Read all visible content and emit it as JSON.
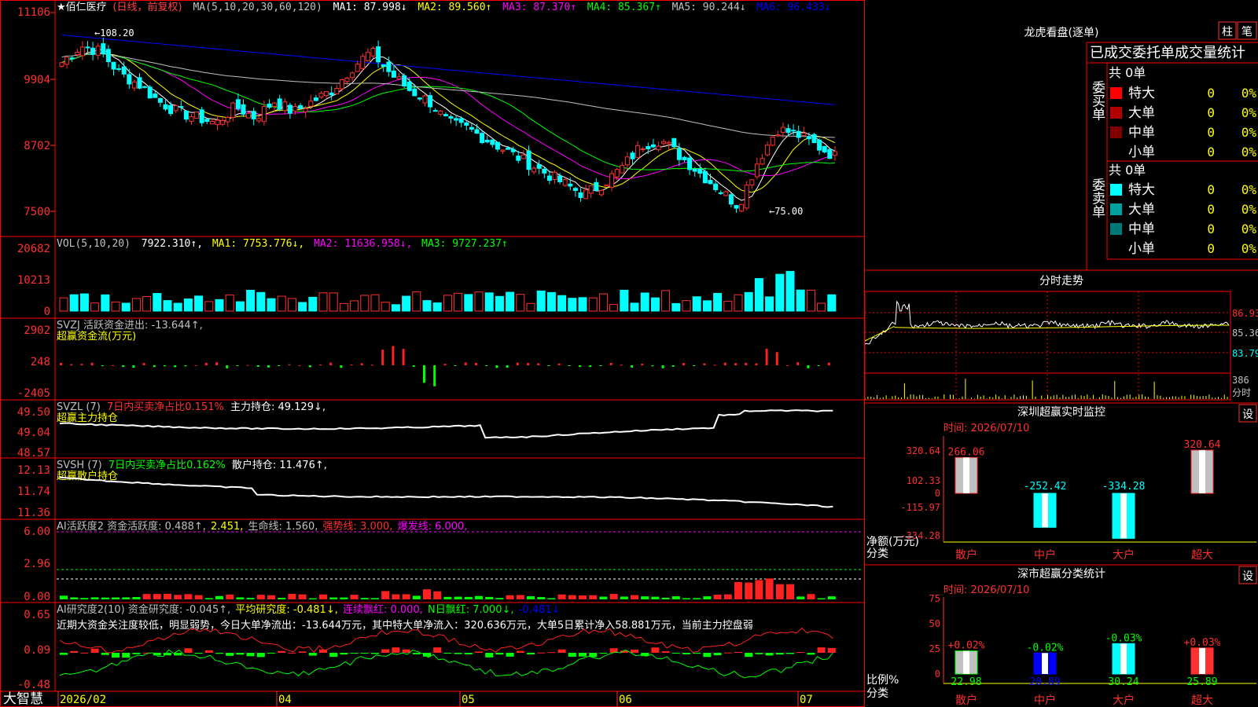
{
  "header": {
    "stock_name": "★佰仁医疗",
    "period": "(日线，前复权)",
    "ma_label": "MA(5,10,20,30,60,120)",
    "ma_values": [
      {
        "text": "MA1: 87.998↓",
        "color": "#ffffff"
      },
      {
        "text": "MA2: 89.560↑",
        "color": "#ffff00"
      },
      {
        "text": "MA3: 87.370↑",
        "color": "#ff00ff"
      },
      {
        "text": "MA4: 85.367↑",
        "color": "#00ff00"
      },
      {
        "text": "MA5: 90.244↓",
        "color": "#c0c0c0"
      },
      {
        "text": "MA6: 96.433↓",
        "color": "#0000ff"
      }
    ]
  },
  "price_axis": [
    "11106",
    "9904",
    "8702",
    "7500"
  ],
  "annotations": {
    "high": "108.20",
    "low": "75.00"
  },
  "vol_panel": {
    "label": "VOL(5,10,20)",
    "items": [
      {
        "text": "7922.310↑,",
        "color": "#ffffff"
      },
      {
        "text": "MA1: 7753.776↓,",
        "color": "#ffff00"
      },
      {
        "text": "MA2: 11636.958↓,",
        "color": "#ff00ff"
      },
      {
        "text": "MA3: 9727.237↑",
        "color": "#00ff00"
      }
    ],
    "axis": [
      "20682",
      "10213",
      "0"
    ]
  },
  "svzj_panel": {
    "label": "SVZJ  活跃资金进出: -13.644↑,",
    "sublabel": "超赢资金流(万元)",
    "axis": [
      "2902",
      "248",
      "-2405"
    ]
  },
  "svzl_panel": {
    "label": "SVZL (7)",
    "item1": "7日内买卖净占比0.151%",
    "item2": "主力持仓: 49.129↓,",
    "sublabel": "超赢主力持仓",
    "axis": [
      "49.50",
      "49.04",
      "48.57"
    ]
  },
  "svsh_panel": {
    "label": "SVSH (7)",
    "item1": "7日内买卖净占比0.162%",
    "item2": "散户持仓: 11.476↑,",
    "sublabel": "超赢散户持仓",
    "axis": [
      "12.13",
      "11.74",
      "11.36"
    ]
  },
  "ai1_panel": {
    "items": [
      {
        "text": "AI活跃度2 资金活跃度: 0.488↑,",
        "color": "#c0c0c0"
      },
      {
        "text": "2.451,",
        "color": "#ffff00"
      },
      {
        "text": "生命线: 1.560,",
        "color": "#c0c0c0"
      },
      {
        "text": "强势线: 3.000,",
        "color": "#ff3030"
      },
      {
        "text": "爆发线: 6.000,",
        "color": "#ff00ff"
      }
    ],
    "axis": [
      "6.00",
      "2.96",
      "0.00"
    ]
  },
  "ai2_panel": {
    "items": [
      {
        "text": "AI研究度2(10) 资金研究度: -0.045↑,",
        "color": "#c0c0c0"
      },
      {
        "text": "平均研究度: -0.481↓,",
        "color": "#ffff00"
      },
      {
        "text": "连续飘红: 0.000,",
        "color": "#ff00ff"
      },
      {
        "text": "N日飘红: 7.000↓,",
        "color": "#00ff00"
      },
      {
        "text": "-0.481↓",
        "color": "#0000ff"
      }
    ],
    "comment": "近期大资金关注度较低，明显弱势，今日大单净流出：-13.644万元，其中特大单净流入：320.636万元，大单5日累计净入58.881万元，当前主力控盘弱",
    "axis": [
      "0.65",
      "0.09",
      "-0.48"
    ]
  },
  "date_axis": {
    "brand": "大智慧",
    "labels": [
      "2026/02",
      "04",
      "05",
      "06",
      "07"
    ]
  },
  "dragon_tiger": {
    "title": "龙虎看盘(逐单)",
    "btn1": "柱",
    "btn2": "笔",
    "subtitle": "已成交委托单成交量统计",
    "buy_label": "委买单",
    "sell_label": "委卖单",
    "buy_total": "共 0单",
    "sell_total": "共 0单",
    "buy_rows": [
      {
        "name": "特大",
        "count": "0",
        "pct": "0%",
        "color": "#ff0000"
      },
      {
        "name": "大单",
        "count": "0",
        "pct": "0%",
        "color": "#b00000"
      },
      {
        "name": "中单",
        "count": "0",
        "pct": "0%",
        "color": "#800000"
      },
      {
        "name": "小单",
        "count": "0",
        "pct": "0%",
        "color": "#000000"
      }
    ],
    "sell_rows": [
      {
        "name": "特大",
        "count": "0",
        "pct": "0%",
        "color": "#00ffff"
      },
      {
        "name": "大单",
        "count": "0",
        "pct": "0%",
        "color": "#00a0a0"
      },
      {
        "name": "中单",
        "count": "0",
        "pct": "0%",
        "color": "#007878"
      },
      {
        "name": "小单",
        "count": "0",
        "pct": "0%",
        "color": "#000000"
      }
    ]
  },
  "intraday": {
    "title": "分时走势",
    "axis": [
      "86.93",
      "85.36",
      "83.79"
    ],
    "vol_label": "386",
    "unit_label": "分时"
  },
  "monitor": {
    "title": "深圳超赢实时监控",
    "btn": "设",
    "date": "时间: 2026/07/10",
    "axis": [
      "320.64",
      "102.33",
      "0",
      "-115.97",
      "-334.28"
    ],
    "unit_top": "净额(万元)",
    "unit_bottom": "分类",
    "bars": [
      {
        "category": "散户",
        "label": "266.06",
        "value": 266.06
      },
      {
        "category": "中户",
        "label": "-252.42",
        "value": -252.42
      },
      {
        "category": "大户",
        "label": "-334.28",
        "value": -334.28
      },
      {
        "category": "超大",
        "label": "320.64",
        "value": 320.64
      }
    ]
  },
  "classify": {
    "title": "深市超赢分类统计",
    "btn": "设",
    "date": "时间: 2026/07/10",
    "axis": [
      "75",
      "50",
      "25",
      "0"
    ],
    "unit_top": "比例%",
    "unit_bottom": "分类",
    "bars": [
      {
        "category": "散户",
        "top": "+0.02%",
        "value": 22.98,
        "bottom": "22.98"
      },
      {
        "category": "中户",
        "top": "-0.02%",
        "value": 20.89,
        "bottom": "20.89"
      },
      {
        "category": "大户",
        "top": "-0.03%",
        "value": 30.24,
        "bottom": "30.24"
      },
      {
        "category": "超大",
        "top": "+0.03%",
        "value": 25.89,
        "bottom": "25.89"
      }
    ]
  },
  "chart_data": [
    {
      "type": "candlestick",
      "title": "★佰仁医疗 (日线，前复权)",
      "ylim": [
        74,
        112
      ],
      "y_ticks": [
        111.06,
        99.04,
        87.02,
        75.0
      ],
      "x_labels": [
        "2026/02",
        "04",
        "05",
        "06",
        "07"
      ],
      "close_anchors": [
        102,
        105,
        104,
        100,
        98,
        95,
        93,
        92,
        91,
        94,
        92,
        95,
        93,
        95,
        97,
        101,
        104,
        100,
        97,
        95,
        91,
        90,
        88,
        86,
        84,
        82,
        80,
        78,
        80,
        83,
        87,
        88,
        85,
        82,
        79,
        76,
        84,
        90,
        89,
        87,
        85
      ],
      "high": 108.2,
      "low": 75.0
    },
    {
      "type": "bar",
      "title": "VOL(5,10,20)",
      "ylim": [
        0,
        20682
      ]
    },
    {
      "type": "bar",
      "title": "SVZJ 活跃资金进出",
      "ylim": [
        -2405,
        2902
      ]
    },
    {
      "type": "line",
      "title": "SVZL 主力持仓",
      "ylim": [
        48.57,
        49.5
      ]
    },
    {
      "type": "line",
      "title": "SVSH 散户持仓",
      "ylim": [
        11.36,
        12.13
      ]
    },
    {
      "type": "bar",
      "title": "AI活跃度2",
      "ylim": [
        0,
        6.0
      ]
    },
    {
      "type": "bar",
      "title": "AI研究度2(10)",
      "ylim": [
        -0.48,
        0.65
      ]
    },
    {
      "type": "bar",
      "title": "深圳超赢实时监控",
      "categories": [
        "散户",
        "中户",
        "大户",
        "超大"
      ],
      "values": [
        266.06,
        -252.42,
        -334.28,
        320.64
      ],
      "ylim": [
        -334.28,
        320.64
      ],
      "ylabel": "净额(万元)"
    },
    {
      "type": "bar",
      "title": "深市超赢分类统计",
      "categories": [
        "散户",
        "中户",
        "大户",
        "超大"
      ],
      "values": [
        22.98,
        20.89,
        30.24,
        25.89
      ],
      "ylim": [
        0,
        75
      ],
      "ylabel": "比例%"
    }
  ]
}
